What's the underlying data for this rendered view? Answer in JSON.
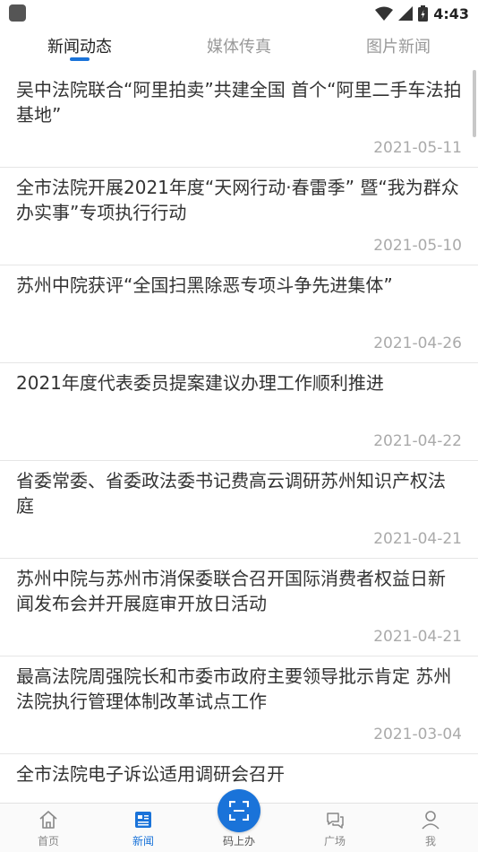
{
  "status_bar": {
    "time": "4:43"
  },
  "tabs": [
    {
      "label": "新闻动态",
      "active": true
    },
    {
      "label": "媒体传真",
      "active": false
    },
    {
      "label": "图片新闻",
      "active": false
    }
  ],
  "news": [
    {
      "title": "吴中法院联合“阿里拍卖”共建全国 首个“阿里二手车法拍基地”",
      "date": "2021-05-11"
    },
    {
      "title": "全市法院开展2021年度“天网行动·春雷季” 暨“我为群众办实事”专项执行行动",
      "date": "2021-05-10"
    },
    {
      "title": "苏州中院获评“全国扫黑除恶专项斗争先进集体”",
      "date": "2021-04-26"
    },
    {
      "title": "2021年度代表委员提案建议办理工作顺利推进",
      "date": "2021-04-22"
    },
    {
      "title": "省委常委、省委政法委书记费高云调研苏州知识产权法庭",
      "date": "2021-04-21"
    },
    {
      "title": "苏州中院与苏州市消保委联合召开国际消费者权益日新闻发布会并开展庭审开放日活动",
      "date": "2021-04-21"
    },
    {
      "title": "最高法院周强院长和市委市政府主要领导批示肯定 苏州法院执行管理体制改革试点工作",
      "date": "2021-03-04"
    },
    {
      "title": "全市法院电子诉讼适用调研会召开",
      "date": ""
    }
  ],
  "bottom_nav": {
    "home": "首页",
    "news": "新闻",
    "scan": "码上办",
    "square": "广场",
    "me": "我"
  },
  "colors": {
    "accent": "#1a73d9",
    "date": "#aaaaaa",
    "inactive_tab": "#999999"
  }
}
